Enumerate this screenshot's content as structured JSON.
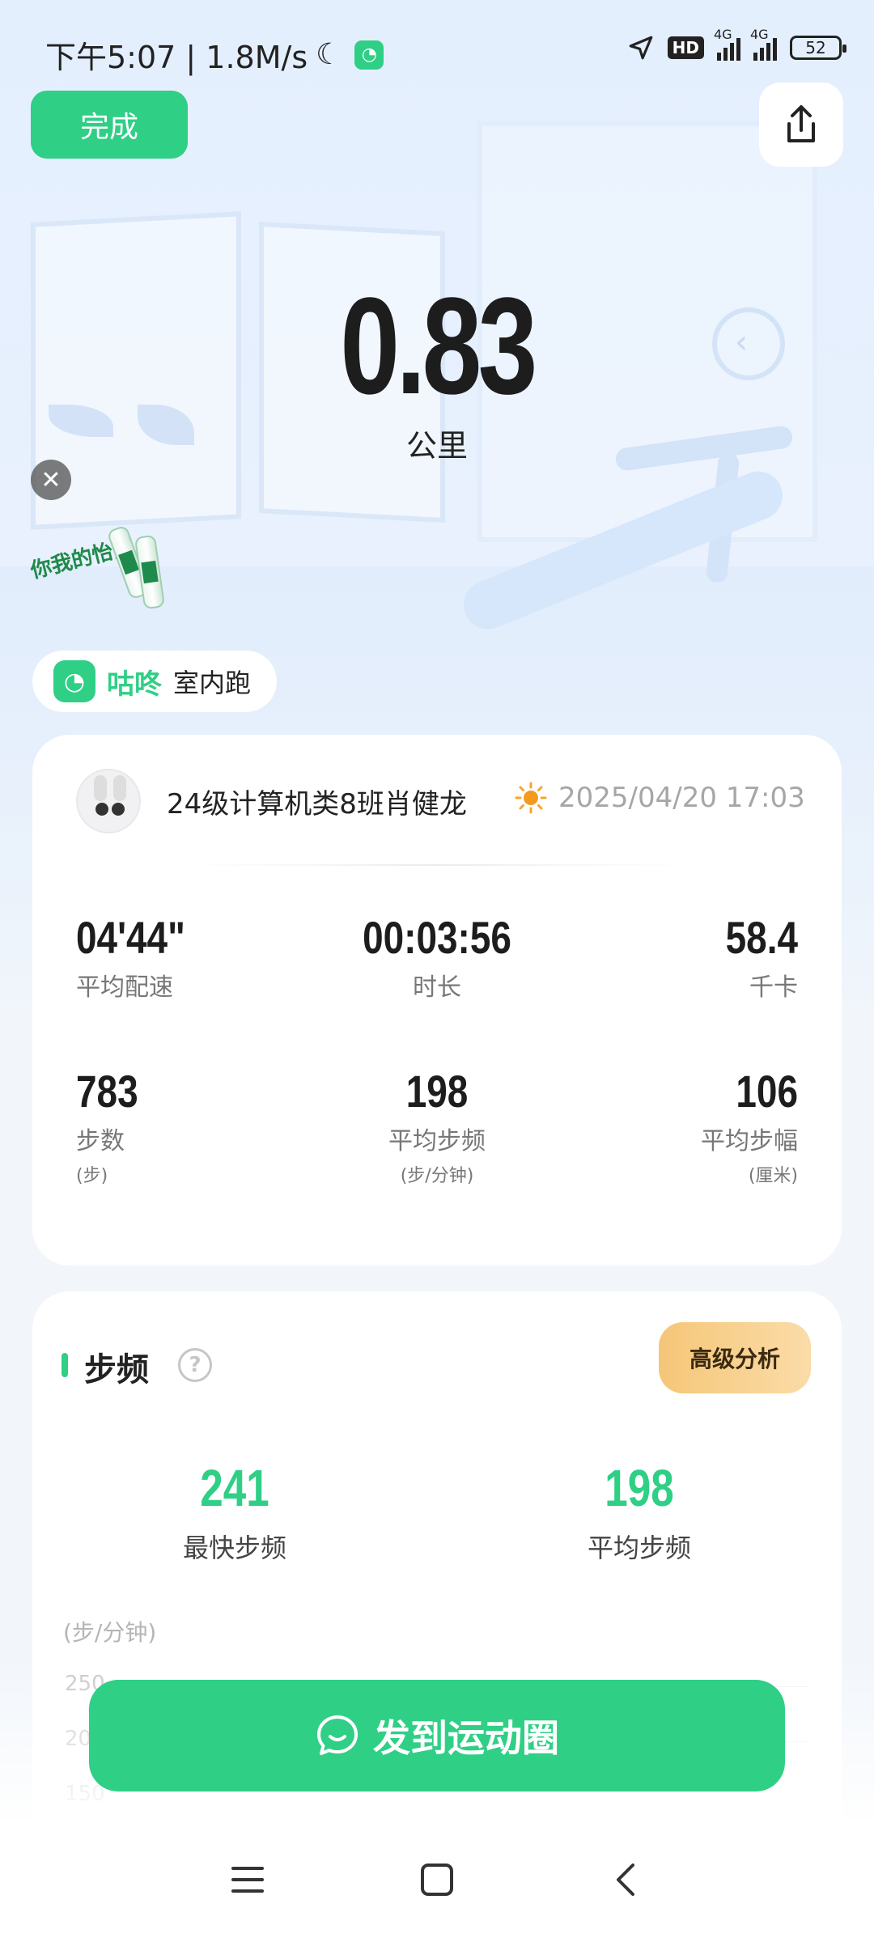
{
  "status_bar": {
    "time_speed": "下午5:07 | 1.8M/s",
    "network_badge": "HD",
    "network_1": "4G",
    "network_2": "4G",
    "battery": "52"
  },
  "header": {
    "done_label": "完成",
    "share_icon": "share-icon"
  },
  "hero": {
    "distance": "0.83",
    "unit": "公里"
  },
  "ad": {
    "close_icon": "close-icon",
    "brand_text": "你我的怡寶"
  },
  "source": {
    "brand": "咕咚",
    "activity": "室内跑"
  },
  "summary": {
    "user_name": "24级计算机类8班肖健龙",
    "weather_icon": "sun-icon",
    "datetime": "2025/04/20 17:03",
    "metrics": [
      {
        "value": "04'44\"",
        "label": "平均配速",
        "sub": ""
      },
      {
        "value": "00:03:56",
        "label": "时长",
        "sub": ""
      },
      {
        "value": "58.4",
        "label": "千卡",
        "sub": ""
      },
      {
        "value": "783",
        "label": "步数",
        "sub": "(步)"
      },
      {
        "value": "198",
        "label": "平均步频",
        "sub": "(步/分钟)"
      },
      {
        "value": "106",
        "label": "平均步幅",
        "sub": "(厘米)"
      }
    ]
  },
  "cadence": {
    "title": "步频",
    "advanced_label": "高级分析",
    "fastest_value": "241",
    "fastest_label": "最快步频",
    "average_value": "198",
    "average_label": "平均步频",
    "chart_unit": "(步/分钟)",
    "ticks": [
      "250",
      "200",
      "150"
    ]
  },
  "actions": {
    "post_label": "发到运动圈"
  },
  "colors": {
    "accent": "#2fcf86",
    "advanced_gradient_start": "#f5c678",
    "advanced_gradient_end": "#fbdca8"
  }
}
